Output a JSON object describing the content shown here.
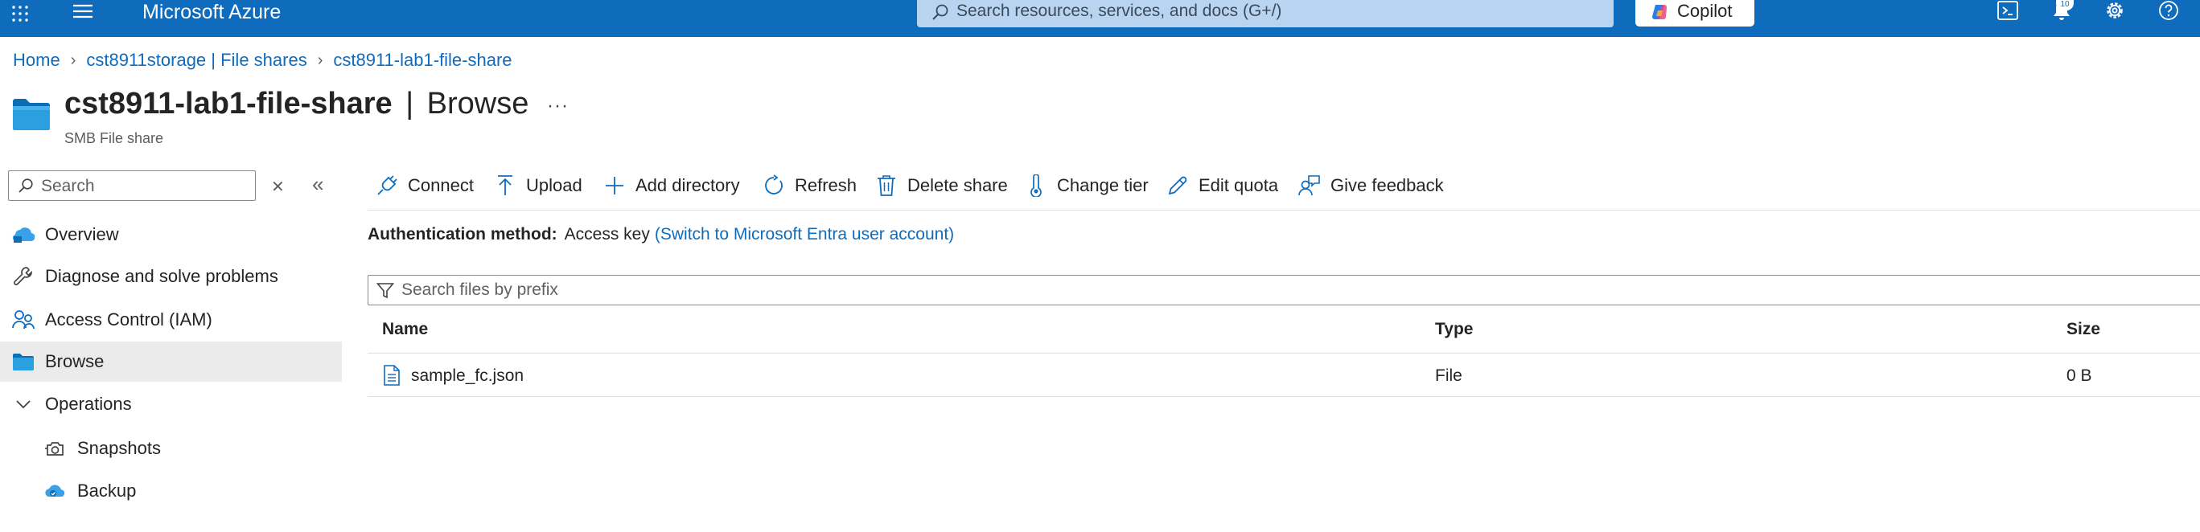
{
  "topbar": {
    "brand": "Microsoft Azure",
    "search_placeholder": "Search resources, services, and docs (G+/)",
    "copilot_label": "Copilot",
    "notification_count": "10",
    "colors": {
      "bar": "#0f6cbd",
      "search_bg": "#b8d4f0"
    },
    "icons": [
      "apps-grid-icon",
      "hamburger-menu-icon",
      "search-icon",
      "copilot-icon",
      "cloud-shell-icon",
      "bell-icon",
      "gear-icon",
      "help-icon"
    ]
  },
  "breadcrumb": [
    "Home",
    "cst8911storage | File shares",
    "cst8911-lab1-file-share"
  ],
  "page": {
    "resource_name": "cst8911-lab1-file-share",
    "separator": "|",
    "view": "Browse",
    "subtitle": "SMB File share",
    "more": "···"
  },
  "nav": {
    "search_placeholder": "Search",
    "items": [
      {
        "label": "Overview",
        "icon": "overview-icon",
        "selected": false,
        "sub": false
      },
      {
        "label": "Diagnose and solve problems",
        "icon": "wrench-icon",
        "selected": false,
        "sub": false
      },
      {
        "label": "Access Control (IAM)",
        "icon": "people-icon",
        "selected": false,
        "sub": false
      },
      {
        "label": "Browse",
        "icon": "folder-icon",
        "selected": true,
        "sub": false
      },
      {
        "label": "Operations",
        "icon": "chevron-down-icon",
        "selected": false,
        "sub": false
      },
      {
        "label": "Snapshots",
        "icon": "snapshot-icon",
        "selected": false,
        "sub": true
      },
      {
        "label": "Backup",
        "icon": "backup-cloud-icon",
        "selected": false,
        "sub": true
      }
    ]
  },
  "toolbar": {
    "connect": "Connect",
    "upload": "Upload",
    "add_directory": "Add directory",
    "refresh": "Refresh",
    "delete_share": "Delete share",
    "change_tier": "Change tier",
    "edit_quota": "Edit quota",
    "give_feedback": "Give feedback"
  },
  "auth": {
    "label": "Authentication method:",
    "value": "Access key",
    "switch_link": "(Switch to Microsoft Entra user account)"
  },
  "filter": {
    "placeholder": "Search files by prefix"
  },
  "table": {
    "columns": [
      "Name",
      "Type",
      "Size"
    ],
    "rows": [
      {
        "name": "sample_fc.json",
        "type": "File",
        "size": "0 B"
      }
    ]
  }
}
